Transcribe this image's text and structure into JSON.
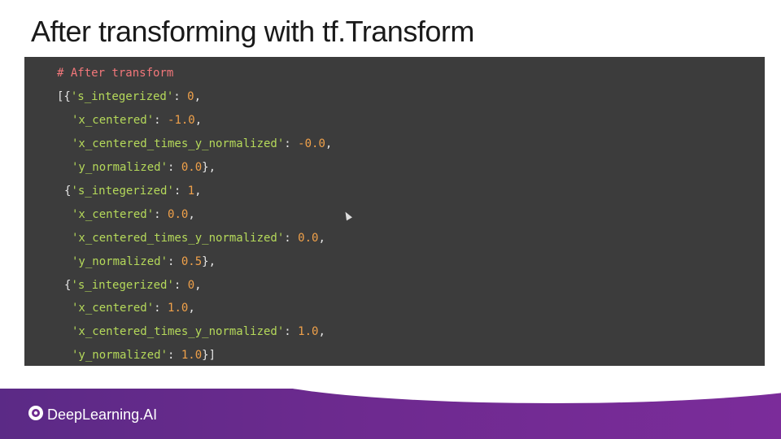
{
  "slide": {
    "title": "After transforming with tf.Transform"
  },
  "code": {
    "comment": "# After transform",
    "records": [
      {
        "s_integerized": "0",
        "x_centered": "-1.0",
        "x_centered_times_y_normalized": "-0.0",
        "y_normalized": "0.0"
      },
      {
        "s_integerized": "1",
        "x_centered": "0.0",
        "x_centered_times_y_normalized": "0.0",
        "y_normalized": "0.5"
      },
      {
        "s_integerized": "0",
        "x_centered": "1.0",
        "x_centered_times_y_normalized": "1.0",
        "y_normalized": "1.0"
      }
    ],
    "keys": {
      "s_integerized": "'s_integerized'",
      "x_centered": "'x_centered'",
      "x_centered_times_y_normalized": "'x_centered_times_y_normalized'",
      "y_normalized": "'y_normalized'"
    }
  },
  "footer": {
    "brand": "DeepLearning.AI"
  },
  "colors": {
    "comment": "#f2777a",
    "string": "#b5d95a",
    "number": "#f0a14a",
    "panel": "#3c3c3c",
    "footer": "#6d2a8f"
  }
}
